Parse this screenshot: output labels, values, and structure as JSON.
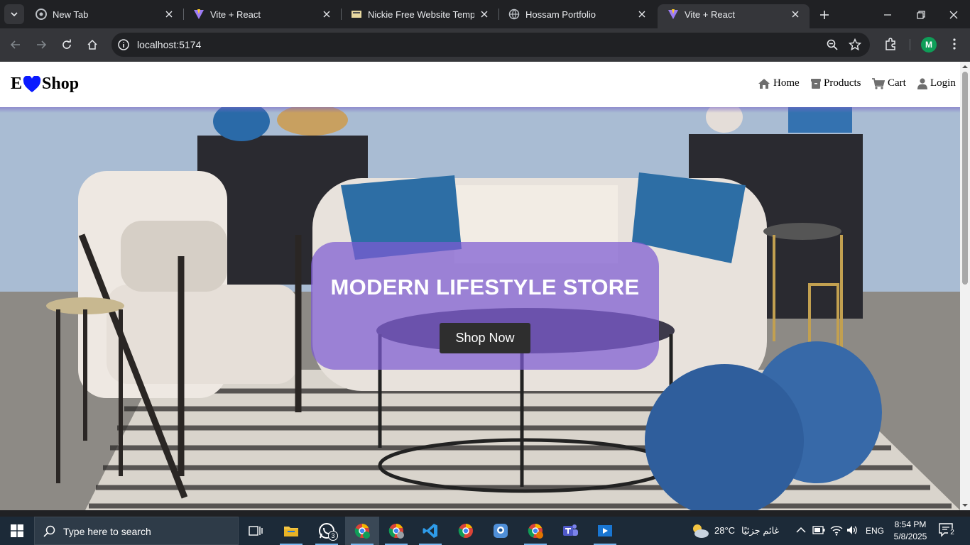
{
  "browser": {
    "tabs": [
      {
        "title": "New Tab",
        "favicon": "chrome-icon",
        "active": false
      },
      {
        "title": "Vite + React",
        "favicon": "vite-icon",
        "active": false
      },
      {
        "title": "Nickie Free Website Templat",
        "favicon": "template-icon",
        "active": false
      },
      {
        "title": "Hossam Portfolio",
        "favicon": "globe-icon",
        "active": false
      },
      {
        "title": "Vite + React",
        "favicon": "vite-icon",
        "active": true
      }
    ],
    "url": "localhost:5174",
    "profile_initial": "M"
  },
  "site": {
    "brand_left": "E",
    "brand_right": "Shop",
    "brand_heart_color": "#0a1aff",
    "nav": [
      {
        "label": "Home",
        "icon": "home-icon"
      },
      {
        "label": "Products",
        "icon": "box-icon"
      },
      {
        "label": "Cart",
        "icon": "cart-icon"
      },
      {
        "label": "Login",
        "icon": "user-icon"
      }
    ],
    "hero": {
      "title": "MODERN LIFESTYLE STORE",
      "button": "Shop Now",
      "card_color": "#7d5cd2"
    }
  },
  "taskbar": {
    "search_placeholder": "Type here to search",
    "apps": [
      {
        "name": "task-view-icon"
      },
      {
        "name": "file-explorer-icon"
      },
      {
        "name": "whatsapp-icon",
        "badge": "3"
      },
      {
        "name": "chrome-profile-m-icon",
        "active": true
      },
      {
        "name": "chrome-profile-2-icon"
      },
      {
        "name": "vscode-icon"
      },
      {
        "name": "chrome-icon"
      },
      {
        "name": "webcam-app-icon"
      },
      {
        "name": "chrome-profile-3-icon"
      },
      {
        "name": "teams-icon"
      },
      {
        "name": "media-app-icon"
      }
    ],
    "weather_temp": "28°C",
    "weather_text": "غائم جزئيًا",
    "language": "ENG",
    "time": "8:54 PM",
    "date": "5/8/2025",
    "notifications": "2"
  }
}
